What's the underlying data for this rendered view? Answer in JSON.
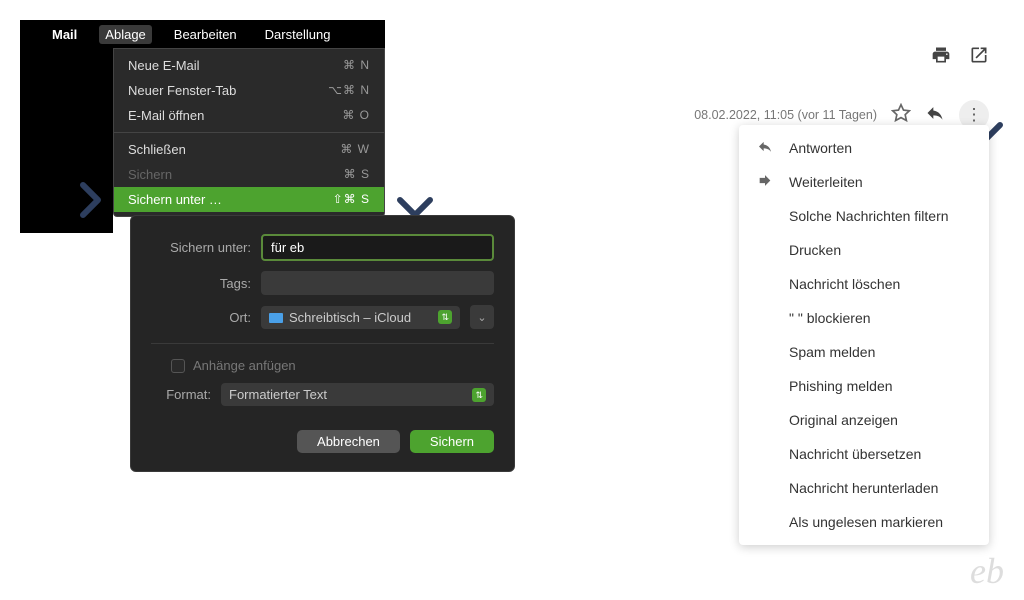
{
  "menubar": {
    "items": [
      "Mail",
      "Ablage",
      "Bearbeiten",
      "Darstellung"
    ]
  },
  "dropdown": {
    "items": [
      {
        "label": "Neue E-Mail",
        "shortcut": "⌘ N"
      },
      {
        "label": "Neuer Fenster-Tab",
        "shortcut": "⌥⌘ N"
      },
      {
        "label": "E-Mail öffnen",
        "shortcut": "⌘ O"
      },
      {
        "label": "Schließen",
        "shortcut": "⌘ W"
      },
      {
        "label": "Sichern",
        "shortcut": "⌘ S",
        "disabled": true
      },
      {
        "label": "Sichern unter …",
        "shortcut": "⇧⌘ S",
        "highlight": true
      }
    ]
  },
  "save_dialog": {
    "filename_label": "Sichern unter:",
    "filename_value": "für eb",
    "tags_label": "Tags:",
    "location_label": "Ort:",
    "location_value": "Schreibtisch – iCloud",
    "attach_label": "Anhänge anfügen",
    "format_label": "Format:",
    "format_value": "Formatierter Text",
    "cancel": "Abbrechen",
    "save": "Sichern"
  },
  "gmail": {
    "timestamp": "08.02.2022, 11:05 (vor 11 Tagen)",
    "menu": [
      {
        "label": "Antworten",
        "icon": "reply"
      },
      {
        "label": "Weiterleiten",
        "icon": "forward"
      },
      {
        "label": "Solche Nachrichten filtern"
      },
      {
        "label": "Drucken"
      },
      {
        "label": "Nachricht löschen"
      },
      {
        "label": "\"                    \" blockieren"
      },
      {
        "label": "Spam melden"
      },
      {
        "label": "Phishing melden"
      },
      {
        "label": "Original anzeigen"
      },
      {
        "label": "Nachricht übersetzen"
      },
      {
        "label": "Nachricht herunterladen"
      },
      {
        "label": "Als ungelesen markieren"
      }
    ]
  },
  "logo": "eb"
}
